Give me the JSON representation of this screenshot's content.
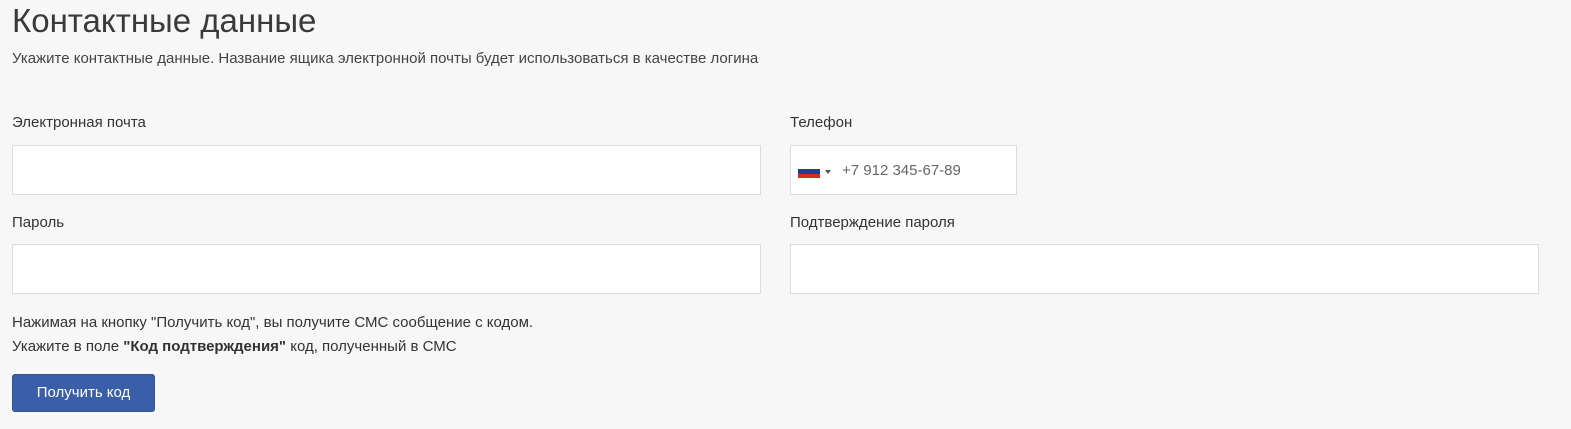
{
  "header": {
    "title": "Контактные данные",
    "subtitle": "Укажите контактные данные. Название ящика электронной почты будет использоваться в качестве логина"
  },
  "form": {
    "email": {
      "label": "Электронная почта",
      "value": "",
      "placeholder": ""
    },
    "phone": {
      "label": "Телефон",
      "value": "",
      "placeholder": "+7 912 345-67-89",
      "country_flag_icon": "russia-flag-icon",
      "flag_colors": [
        "#ffffff",
        "#1c3f95",
        "#d52b1e"
      ],
      "dropdown_icon": "caret-down-icon"
    },
    "password": {
      "label": "Пароль",
      "value": "",
      "placeholder": ""
    },
    "password_confirm": {
      "label": "Подтверждение пароля",
      "value": "",
      "placeholder": ""
    }
  },
  "info": {
    "line1": "Нажимая на кнопку \"Получить код\", вы получите СМС сообщение с кодом.",
    "line2_prefix": "Укажите в поле ",
    "line2_bold": "\"Код подтверждения\"",
    "line2_suffix": " код, полученный в СМС"
  },
  "actions": {
    "get_code_label": "Получить код",
    "button_color": "#3b5ea8"
  }
}
